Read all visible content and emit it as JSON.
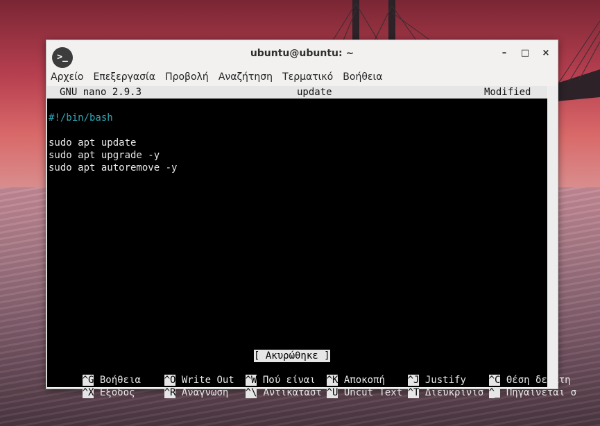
{
  "window": {
    "title": "ubuntu@ubuntu: ~",
    "app_icon": "terminal-prompt-icon",
    "buttons": {
      "minimize": "–",
      "maximize": "□",
      "close": "×"
    }
  },
  "menubar": {
    "items": [
      "Αρχείο",
      "Επεξεργασία",
      "Προβολή",
      "Αναζήτηση",
      "Τερματικό",
      "Βοήθεια"
    ]
  },
  "nano": {
    "version": "GNU nano 2.9.3",
    "filename": "update",
    "state": "Modified",
    "lines": [
      "#!/bin/bash",
      "",
      "sudo apt update",
      "sudo apt upgrade -y",
      "sudo apt autoremove -y"
    ],
    "status_message": "[ Ακυρώθηκε ]",
    "shortcuts_row1": [
      {
        "key": "^G",
        "label": "Βοήθεια"
      },
      {
        "key": "^O",
        "label": "Write Out"
      },
      {
        "key": "^W",
        "label": "Πού είναι"
      },
      {
        "key": "^K",
        "label": "Αποκοπή"
      },
      {
        "key": "^J",
        "label": "Justify"
      },
      {
        "key": "^C",
        "label": "Θέση δείκτη"
      }
    ],
    "shortcuts_row2": [
      {
        "key": "^X",
        "label": "Έξοδος"
      },
      {
        "key": "^R",
        "label": "Ανάγνωση"
      },
      {
        "key": "^\\",
        "label": "Αντικατάστ"
      },
      {
        "key": "^U",
        "label": "Uncut Text"
      },
      {
        "key": "^T",
        "label": "Διευκρίνισ"
      },
      {
        "key": "^_",
        "label": "Πηγαίνεται σ"
      }
    ]
  },
  "colors": {
    "terminal_bg": "#000000",
    "terminal_fg": "#e8e8e8",
    "shebang": "#2fa6b4",
    "nano_bar": "#e6e6e6"
  }
}
